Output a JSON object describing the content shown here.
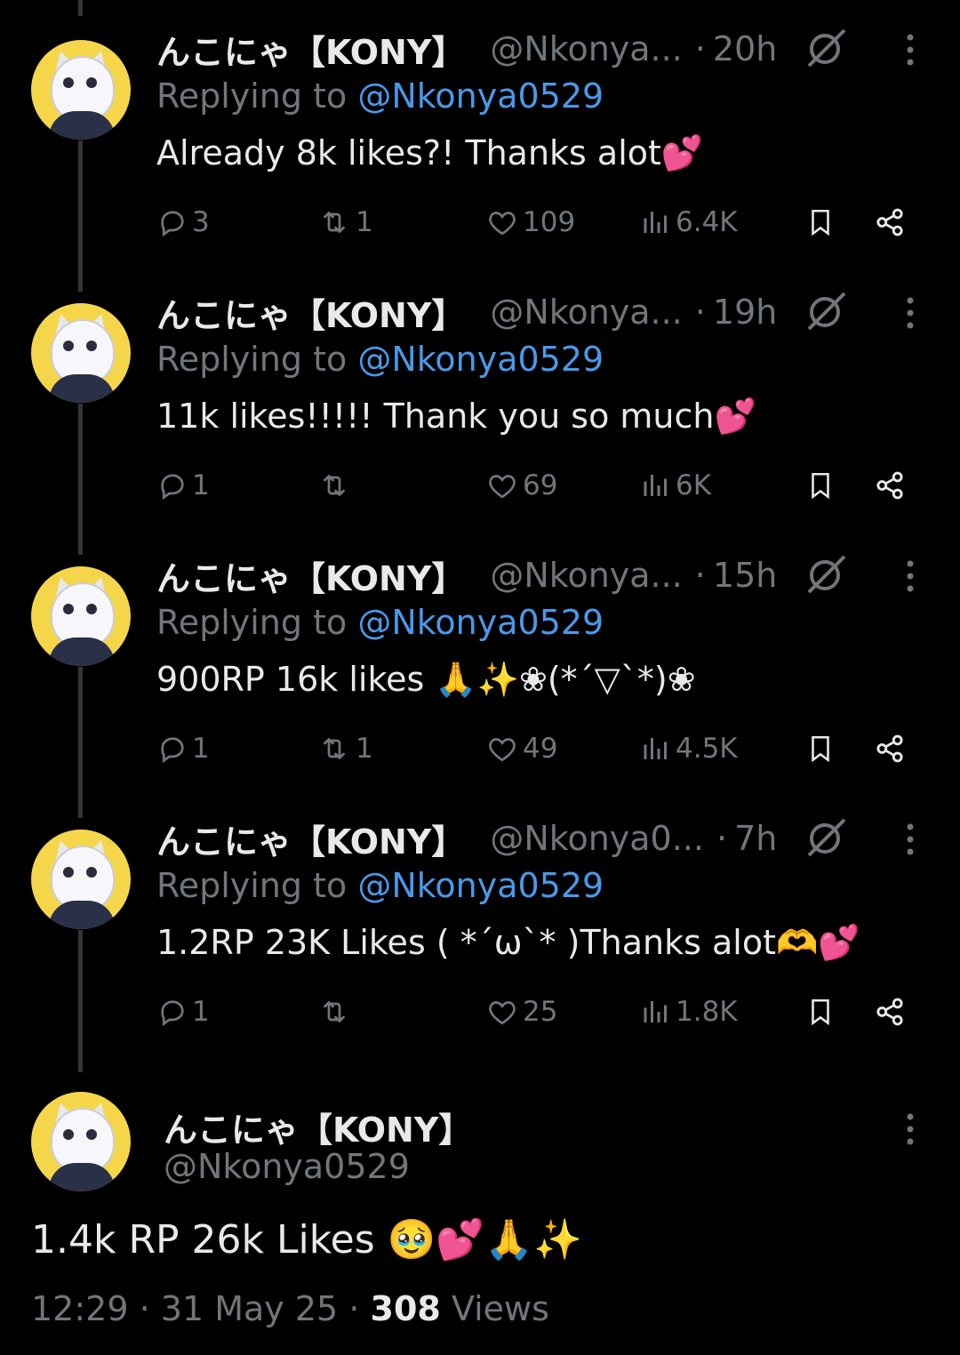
{
  "replies": [
    {
      "name": "んこにゃ【KONY】",
      "handle": "@Nkonya...",
      "dot": "·",
      "time": "20h",
      "replying_prefix": "Replying to",
      "replying_to": "@Nkonya0529",
      "text": "Already 8k likes?! Thanks alot💕",
      "replies": "3",
      "reposts": "1",
      "likes": "109",
      "views": "6.4K"
    },
    {
      "name": "んこにゃ【KONY】",
      "handle": "@Nkonya...",
      "dot": "·",
      "time": "19h",
      "replying_prefix": "Replying to",
      "replying_to": "@Nkonya0529",
      "text": "11k likes!!!!! Thank you so much💕",
      "replies": "1",
      "reposts": "",
      "likes": "69",
      "views": "6K"
    },
    {
      "name": "んこにゃ【KONY】",
      "handle": "@Nkonya...",
      "dot": "·",
      "time": "15h",
      "replying_prefix": "Replying to",
      "replying_to": "@Nkonya0529",
      "text": "900RP 16k likes 🙏✨❀(*´▽`*)❀",
      "replies": "1",
      "reposts": "1",
      "likes": "49",
      "views": "4.5K"
    },
    {
      "name": "んこにゃ【KONY】",
      "handle": "@Nkonya0...",
      "dot": "·",
      "time": "7h",
      "replying_prefix": "Replying to",
      "replying_to": "@Nkonya0529",
      "text": "1.2RP 23K Likes ( *´ω`* )Thanks alot🫶💕",
      "replies": "1",
      "reposts": "",
      "likes": "25",
      "views": "1.8K"
    }
  ],
  "main_post": {
    "name": "んこにゃ【KONY】",
    "handle": "@Nkonya0529",
    "text": "1.4k RP 26k Likes 🥹💕🙏✨",
    "time": "12:29",
    "sep1": "·",
    "date": "31 May 25",
    "sep2": "·",
    "views_count": "308",
    "views_label": "Views"
  },
  "colors": {
    "background": "#000000",
    "text": "#e7e9ea",
    "muted": "#71767b",
    "link": "#4a99e9",
    "avatar_bg": "#f5d64b"
  },
  "icons": [
    "reply-icon",
    "repost-icon",
    "like-icon",
    "views-icon",
    "bookmark-icon",
    "share-icon",
    "grok-icon",
    "more-icon"
  ]
}
